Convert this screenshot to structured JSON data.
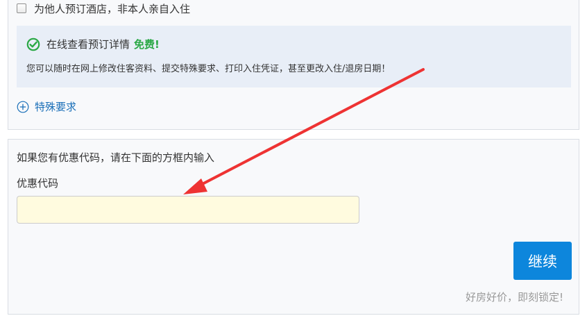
{
  "booking": {
    "checkbox_label": "为他人预订酒店，非本人亲自入住",
    "checkbox_checked": false
  },
  "info": {
    "title": "在线查看预订详情",
    "free_label": "免费!",
    "description": "您可以随时在网上修改住客资料、提交特殊要求、打印入住凭证，甚至更改入住/退房日期！",
    "icon": "check-circle-icon",
    "accent_color": "#2aa845"
  },
  "special_requests": {
    "label": "特殊要求",
    "icon": "plus-circle-icon"
  },
  "promo": {
    "hint": "如果您有优惠代码，请在下面的方框内输入",
    "label": "优惠代码",
    "value": "",
    "placeholder": ""
  },
  "actions": {
    "continue_label": "继续",
    "tagline": "好房好价，即刻锁定!"
  },
  "colors": {
    "primary_button": "#0d86dc",
    "link": "#1a6fb8",
    "input_background": "#fffbdf",
    "annotation_arrow": "#ee3333"
  }
}
